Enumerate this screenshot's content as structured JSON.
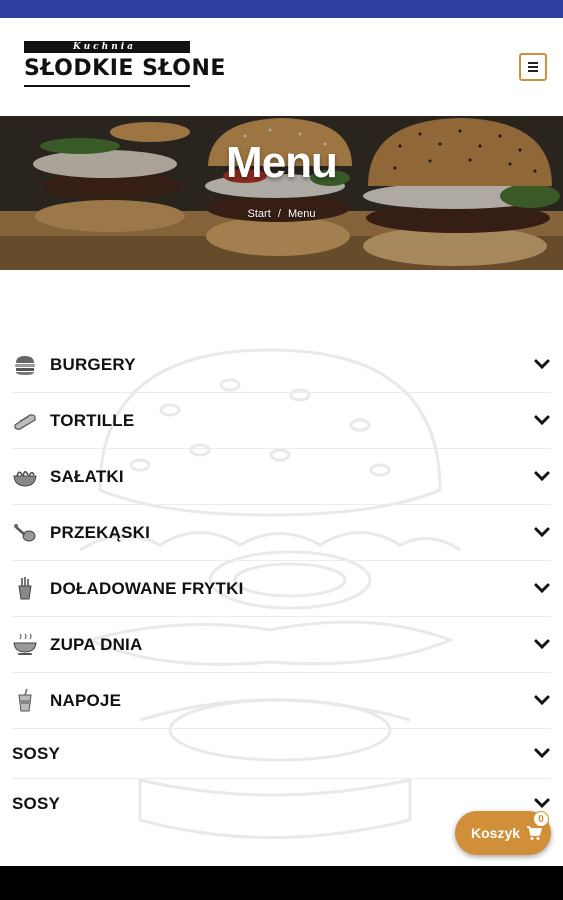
{
  "brand": {
    "top_word": "Kuchnia",
    "name": "SŁODKIE SŁONE"
  },
  "colors": {
    "top_bar": "#2e3d9e",
    "accent": "#d18f3a",
    "bottom_bar": "#000000"
  },
  "header": {
    "menu_toggle_icon": "hamburger-icon"
  },
  "hero": {
    "title": "Menu",
    "breadcrumb": {
      "home": "Start",
      "separator": "/",
      "current": "Menu"
    }
  },
  "menu": {
    "categories": [
      {
        "label": "BURGERY",
        "icon": "burger-icon"
      },
      {
        "label": "TORTILLE",
        "icon": "tortilla-icon"
      },
      {
        "label": "SAŁATKI",
        "icon": "salad-icon"
      },
      {
        "label": "PRZEKĄSKI",
        "icon": "snack-icon"
      },
      {
        "label": "DOŁADOWANE FRYTKI",
        "icon": "fries-icon"
      },
      {
        "label": "ZUPA DNIA",
        "icon": "soup-icon"
      },
      {
        "label": "NAPOJE",
        "icon": "drink-icon"
      },
      {
        "label": "SOSY",
        "icon": ""
      },
      {
        "label": "SOSY",
        "icon": ""
      }
    ]
  },
  "cart": {
    "label": "Koszyk",
    "count": "0",
    "icon": "cart-icon"
  }
}
